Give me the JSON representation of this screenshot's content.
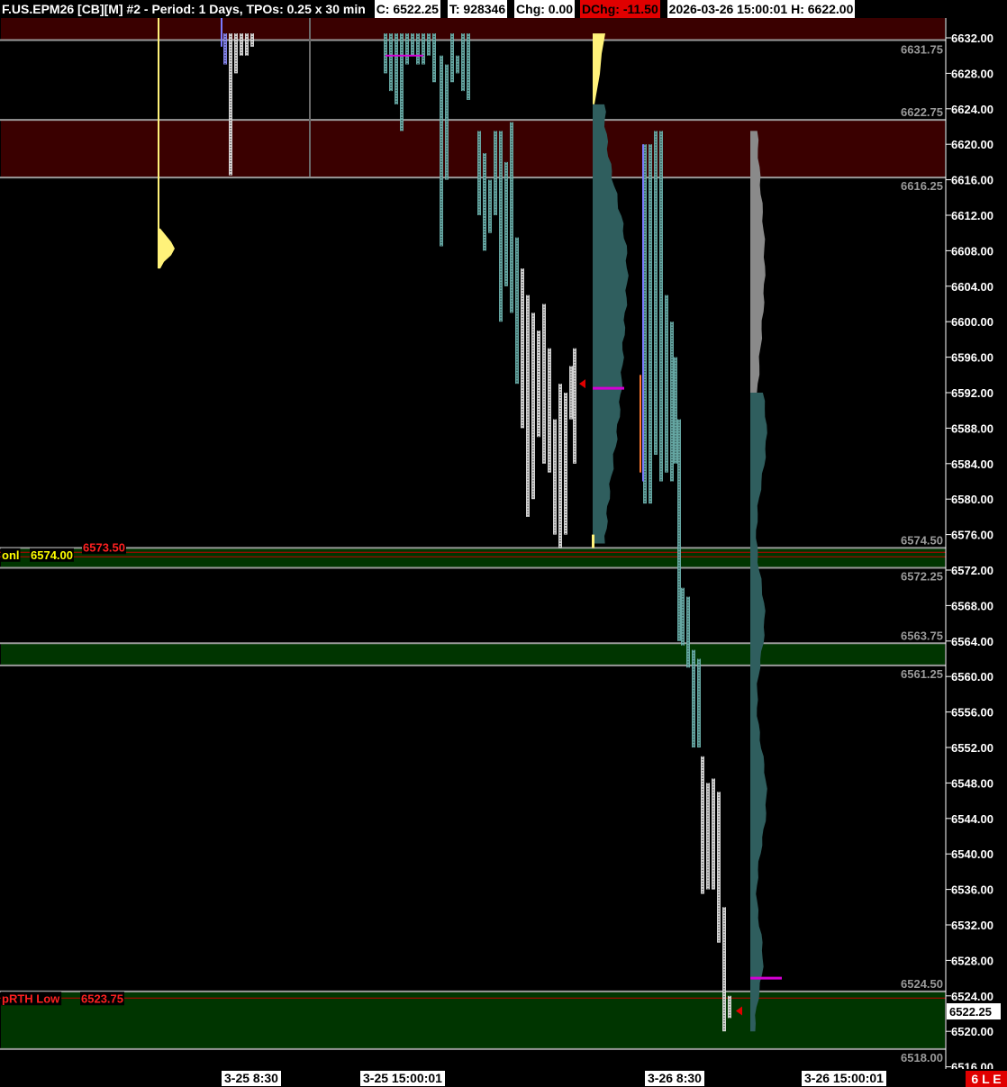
{
  "header": {
    "title": "F.US.EPM26 [CB][M] #2 - Period: 1 Days, TPOs: 0.25 x 30 min",
    "close": "C: 6522.25",
    "total": "T: 928346",
    "chg": "Chg: 0.00",
    "dchg_label": "DChg:",
    "dchg_value": "-11.50",
    "datetime": "2026-03-26 15:00:01",
    "high": "H: 6622.00"
  },
  "price_axis": {
    "ticks": [
      "6632.00",
      "6628.00",
      "6624.00",
      "6620.00",
      "6616.00",
      "6612.00",
      "6608.00",
      "6604.00",
      "6600.00",
      "6596.00",
      "6592.00",
      "6588.00",
      "6584.00",
      "6580.00",
      "6576.00",
      "6572.00",
      "6568.00",
      "6564.00",
      "6560.00",
      "6556.00",
      "6552.00",
      "6548.00",
      "6544.00",
      "6540.00",
      "6536.00",
      "6532.00",
      "6528.00",
      "6524.00",
      "6520.00",
      "6516.00"
    ],
    "current_price": "6522.25"
  },
  "zones": [
    {
      "top": "6631.75",
      "bottom": "",
      "color": "#3a0000"
    },
    {
      "top": "6622.75",
      "bottom": "6616.25",
      "color": "#3a0000"
    },
    {
      "top": "6574.50",
      "bottom": "6572.25",
      "color": "#003500"
    },
    {
      "top": "6563.75",
      "bottom": "6561.25",
      "color": "#003500"
    },
    {
      "top": "6524.50",
      "bottom": "6518.00",
      "color": "#003500"
    }
  ],
  "level_labels": {
    "onl_name": "onl",
    "onl_value": "6574.00",
    "onl_red": "6573.50",
    "prth_name": "pRTH Low",
    "prth_value": "6523.75"
  },
  "time_axis": [
    "3-25  8:30",
    "3-25  15:00:01",
    "3-26  8:30",
    "3-26  15:00:01"
  ],
  "corner_badge": "6 L E",
  "colors": {
    "zone_red": "#3a0000",
    "zone_green": "#003500",
    "tpo_teal": "#6fb7b3",
    "tpo_white": "#e8e8e8",
    "profile_teal": "#2f5e5e",
    "profile_gray": "#8a8a8a",
    "profile_yellow": "#fff27a",
    "poc_magenta": "#d400d4"
  }
}
